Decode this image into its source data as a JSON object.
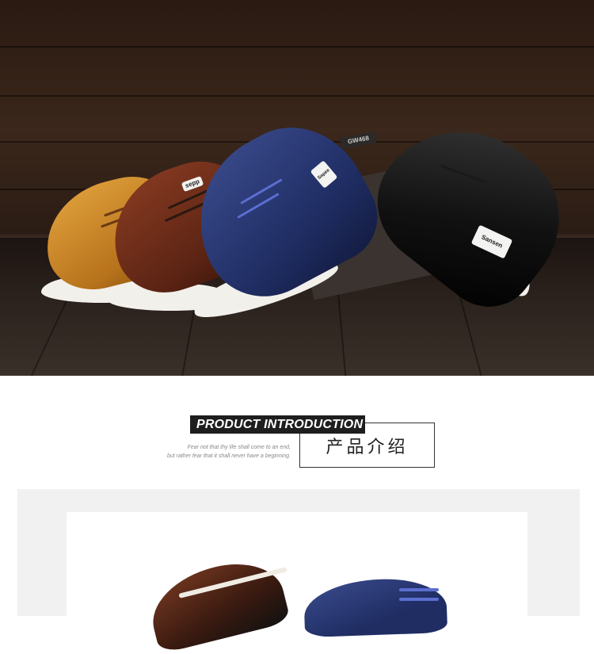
{
  "section": {
    "title_en": "PRODUCT INTRODUCTION",
    "title_cn": "产品介绍",
    "subtitle_line1": "Fear not that thy life shall come to an end,",
    "subtitle_line2": "but rather fear that it shall never have a beginning."
  },
  "hero": {
    "badges": [
      "sepp",
      "Sapee",
      "Sansen",
      "GW468"
    ]
  },
  "colors": {
    "tan": "#c9862a",
    "brown": "#6b2f1b",
    "navy": "#1f2d63",
    "black": "#0f0f0f"
  }
}
